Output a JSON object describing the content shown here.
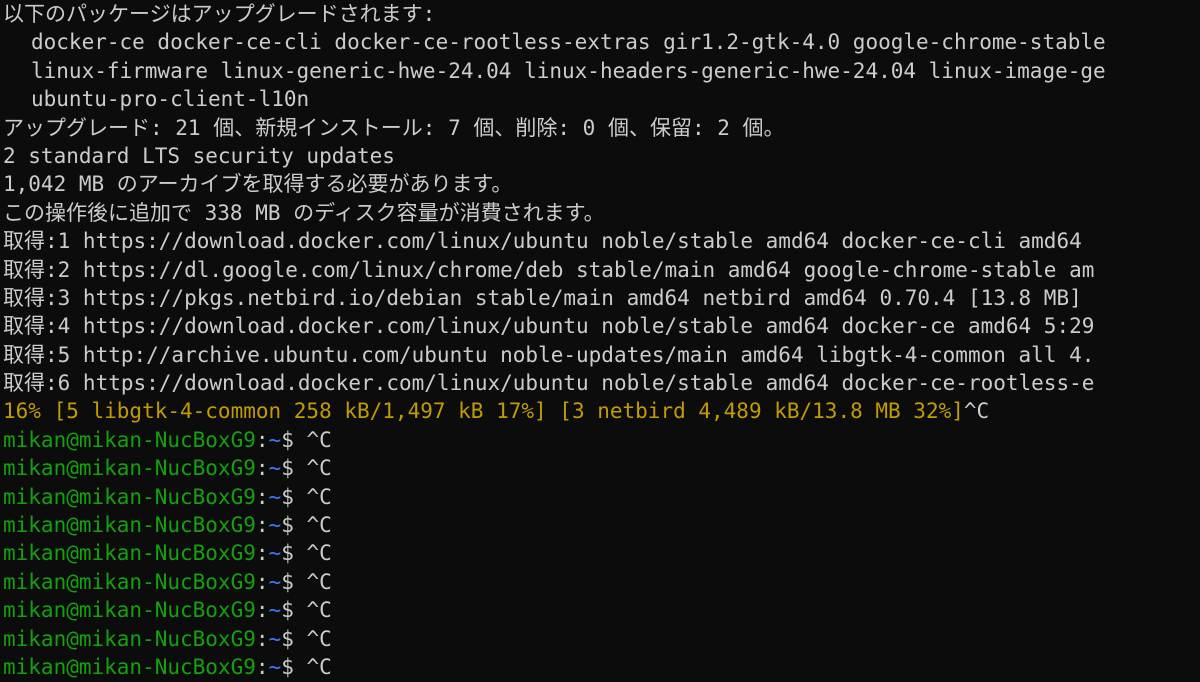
{
  "colors": {
    "background": "#0c0c0c",
    "text": "#cccccc",
    "prompt_user": "#13a10e",
    "prompt_path": "#3b78ff",
    "progress": "#c19c00"
  },
  "output": {
    "upgrade_header": "以下のパッケージはアップグレードされます:",
    "packages": [
      "docker-ce docker-ce-cli docker-ce-rootless-extras gir1.2-gtk-4.0 google-chrome-stable",
      "linux-firmware linux-generic-hwe-24.04 linux-headers-generic-hwe-24.04 linux-image-ge",
      "ubuntu-pro-client-l10n"
    ],
    "summary": "アップグレード: 21 個、新規インストール: 7 個、削除: 0 個、保留: 2 個。",
    "security": "2 standard LTS security updates",
    "archive_size": "1,042 MB のアーカイブを取得する必要があります。",
    "disk_usage": "この操作後に追加で 338 MB のディスク容量が消費されます。",
    "gets": [
      "取得:1 https://download.docker.com/linux/ubuntu noble/stable amd64 docker-ce-cli amd64",
      "取得:2 https://dl.google.com/linux/chrome/deb stable/main amd64 google-chrome-stable am",
      "取得:3 https://pkgs.netbird.io/debian stable/main amd64 netbird amd64 0.70.4 [13.8 MB]",
      "取得:4 https://download.docker.com/linux/ubuntu noble/stable amd64 docker-ce amd64 5:29",
      "取得:5 http://archive.ubuntu.com/ubuntu noble-updates/main amd64 libgtk-4-common all 4.",
      "取得:6 https://download.docker.com/linux/ubuntu noble/stable amd64 docker-ce-rootless-e"
    ],
    "progress": "16% [5 libgtk-4-common 258 kB/1,497 kB 17%] [3 netbird 4,489 kB/13.8 MB 32%]",
    "progress_interrupt": "^C"
  },
  "prompt": {
    "user_host": "mikan@mikan-NucBoxG9",
    "colon": ":",
    "path": "~",
    "dollar": "$ ",
    "command": "^C"
  }
}
